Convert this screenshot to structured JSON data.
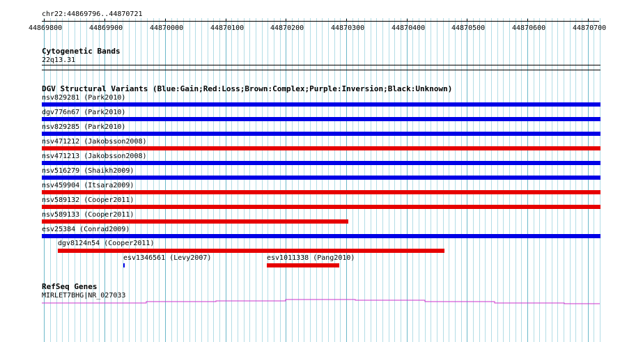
{
  "ruler": {
    "position": "chr22:44869796..44870721",
    "labels": [
      "44869800",
      "44869900",
      "44870000",
      "44870100",
      "44870200",
      "44870300",
      "44870400",
      "44870500",
      "44870600",
      "44870700"
    ],
    "start": 44869796,
    "end": 44870721
  },
  "cytobands": {
    "title": "Cytogenetic Bands",
    "band": "22q13.31"
  },
  "dgv": {
    "title": "DGV Structural Variants (Blue:Gain;Red:Loss;Brown:Complex;Purple:Inversion;Black:Unknown)",
    "colors": {
      "gain": "#0000e6",
      "loss": "#e60000"
    },
    "features": [
      {
        "label": "nsv829281 (Park2010)",
        "type": "gain",
        "start": 44869796,
        "end": 44870721
      },
      {
        "label": "dgv776n67 (Park2010)",
        "type": "gain",
        "start": 44869796,
        "end": 44870721
      },
      {
        "label": "nsv829285 (Park2010)",
        "type": "gain",
        "start": 44869796,
        "end": 44870721
      },
      {
        "label": "nsv471212 (Jakobsson2008)",
        "type": "loss",
        "start": 44869796,
        "end": 44870721
      },
      {
        "label": "nsv471213 (Jakobsson2008)",
        "type": "gain",
        "start": 44869796,
        "end": 44870721
      },
      {
        "label": "nsv516279 (Shaikh2009)",
        "type": "gain",
        "start": 44869796,
        "end": 44870721
      },
      {
        "label": "nsv459904 (Itsara2009)",
        "type": "loss",
        "start": 44869796,
        "end": 44870721
      },
      {
        "label": "nsv589132 (Cooper2011)",
        "type": "loss",
        "start": 44869796,
        "end": 44870721
      },
      {
        "label": "nsv589133 (Cooper2011)",
        "type": "loss",
        "start": 44869796,
        "end": 44870304
      },
      {
        "label": "esv25384 (Conrad2009)",
        "type": "gain",
        "start": 44869796,
        "end": 44870721
      },
      {
        "label": "dgv8124n54 (Cooper2011)",
        "type": "loss",
        "start": 44869823,
        "end": 44870463
      },
      {
        "label": "esv1346561 (Levy2007)",
        "type": "gain",
        "start": 44869931,
        "end": 44869932
      },
      {
        "label": "esv1011338 (Pang2010)",
        "type": "loss",
        "start": 44870168,
        "end": 44870288
      }
    ]
  },
  "refseq": {
    "title": "RefSeq Genes",
    "gene": "MIRLET7BHG|NR_027033",
    "color": "#cc33cc"
  }
}
